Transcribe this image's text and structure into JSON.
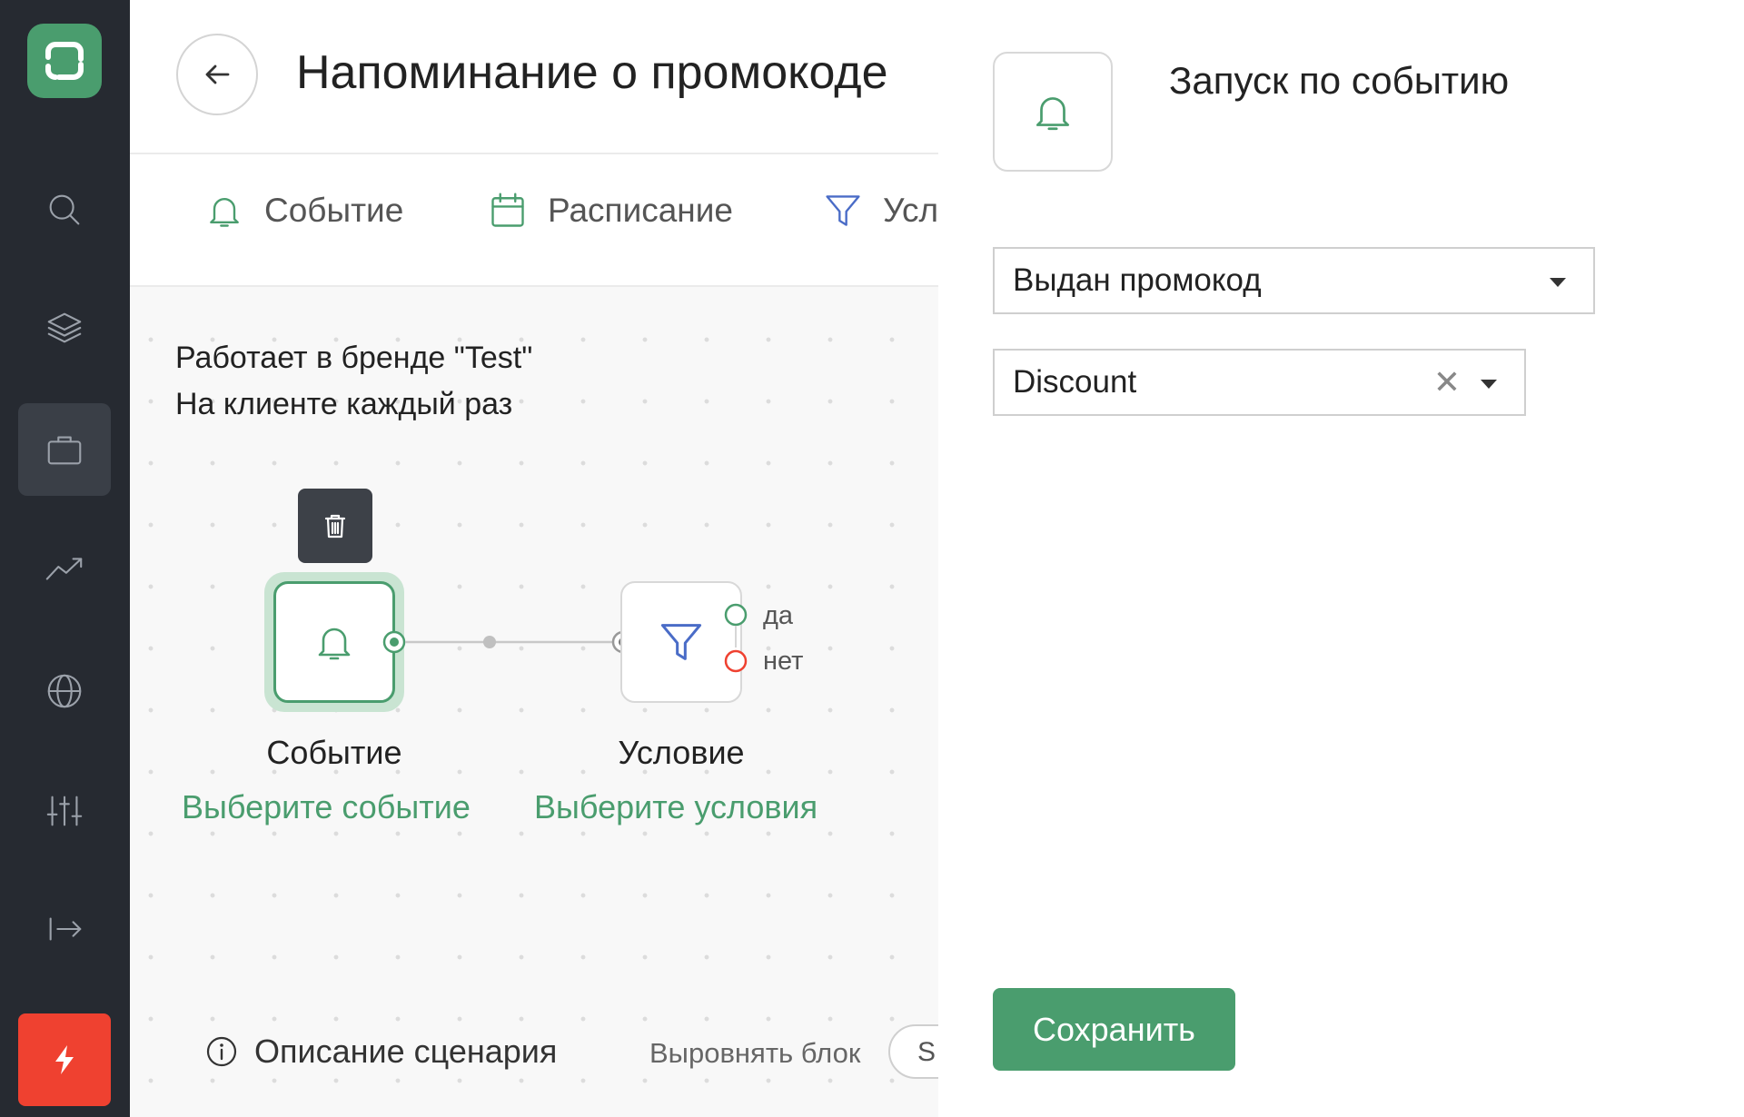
{
  "header": {
    "title": "Напоминание о промокоде"
  },
  "tabs": [
    {
      "label": "Событие",
      "icon": "bell-icon"
    },
    {
      "label": "Расписание",
      "icon": "calendar-icon"
    },
    {
      "label": "Усл",
      "icon": "funnel-icon"
    }
  ],
  "info": {
    "line1": "Работает в бренде \"Test\"",
    "line2": "На клиенте каждый раз"
  },
  "nodes": {
    "event": {
      "title": "Событие",
      "link": "Выберите событие"
    },
    "condition": {
      "title": "Условие",
      "link": "Выберите условия",
      "yes": "да",
      "no": "нет"
    }
  },
  "footer": {
    "description_label": "Описание сценария",
    "align_label": "Выровнять блок",
    "align_pill": "S"
  },
  "panel": {
    "title": "Запуск по событию",
    "event_select": "Выдан промокод",
    "promo_select": "Discount",
    "save_label": "Сохранить"
  },
  "colors": {
    "accent": "#4a9d6e",
    "sidebar": "#262a31",
    "danger": "#ef4130",
    "condition_icon": "#4a6cc7"
  }
}
